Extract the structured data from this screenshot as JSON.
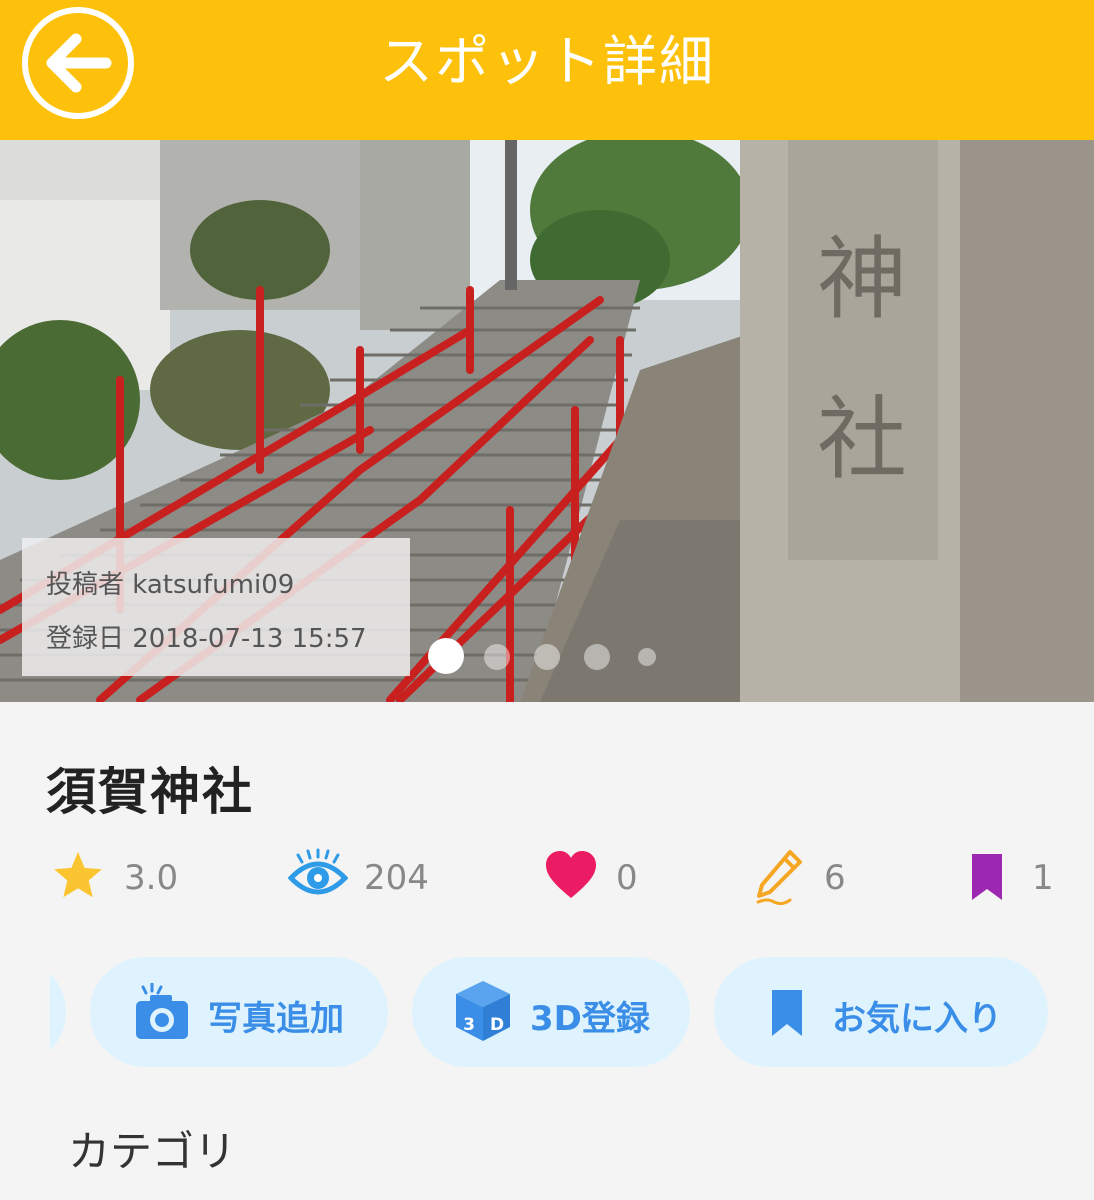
{
  "header": {
    "title": "スポット詳細",
    "back_icon": "arrow-left-icon",
    "color": "#fec10b"
  },
  "photo": {
    "poster_label": "投稿者 katsufumi09",
    "date_label": "登録日 2018-07-13 15:57",
    "carousel_count": 5,
    "carousel_active": 0
  },
  "spot": {
    "name": "須賀神社"
  },
  "stats": {
    "rating": {
      "icon": "star-icon",
      "value": "3.0",
      "color": "#fbc531"
    },
    "views": {
      "icon": "eye-icon",
      "value": "204",
      "color": "#2e9be8"
    },
    "likes": {
      "icon": "heart-icon",
      "value": "0",
      "color": "#ec1c64"
    },
    "posts": {
      "icon": "pencil-icon",
      "value": "6",
      "color": "#f5a623"
    },
    "bookmarks": {
      "icon": "bookmark-icon",
      "value": "1",
      "color": "#9c27b0"
    }
  },
  "actions": {
    "add_photo": {
      "icon": "camera-icon",
      "label": "写真追加"
    },
    "register_3d": {
      "icon": "cube-3d-icon",
      "label": "3D登録"
    },
    "favorite": {
      "icon": "bookmark-icon",
      "label": "お気に入り"
    },
    "accent": "#3a8ee8"
  },
  "section": {
    "category_label": "カテゴリ"
  }
}
